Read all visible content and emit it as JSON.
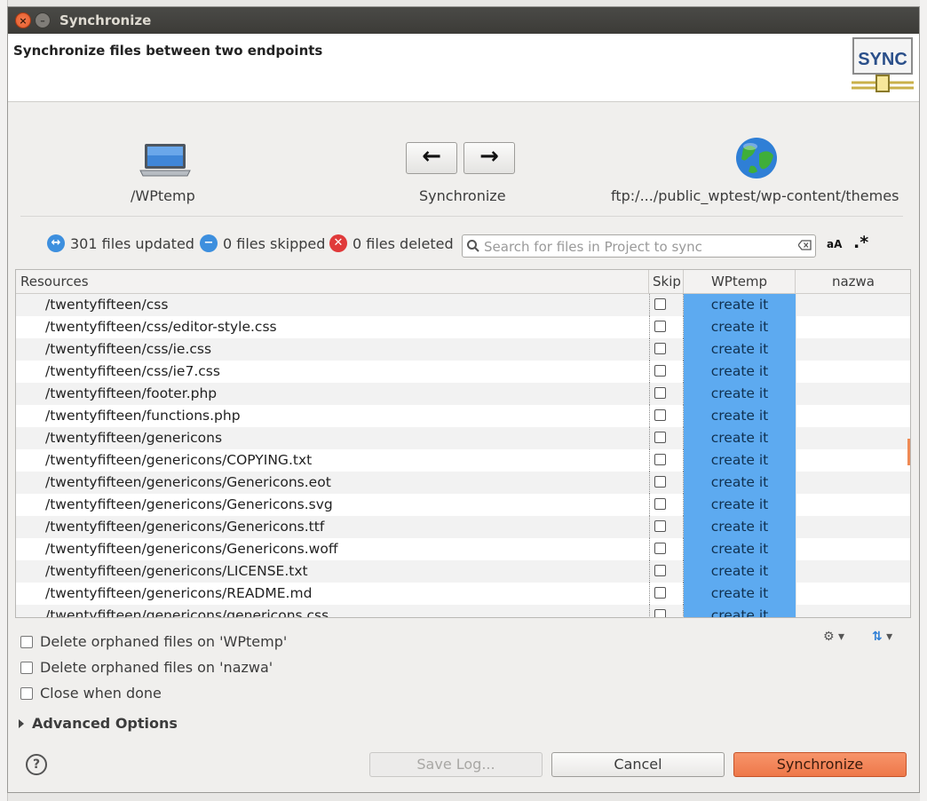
{
  "window": {
    "title": "Synchronize"
  },
  "banner": {
    "title": "Synchronize files between two endpoints",
    "logo_text": "SYNC"
  },
  "endpoints": {
    "source_label": "/WPtemp",
    "action_label": "Synchronize",
    "destination_label": "ftp:/.../public_wptest/wp-content/themes",
    "left_arrow": "←",
    "right_arrow": "→"
  },
  "stats": {
    "updated": "301 files updated",
    "skipped": "0 files skipped",
    "deleted": "0 files deleted"
  },
  "search": {
    "placeholder": "Search for files in Project to sync",
    "case_label": "aA",
    "regex_label": ".*"
  },
  "table": {
    "columns": {
      "resources": "Resources",
      "skip": "Skip",
      "source": "WPtemp",
      "destination": "nazwa"
    },
    "rows": [
      {
        "path": "/twentyfifteen/css",
        "action": "create it"
      },
      {
        "path": "/twentyfifteen/css/editor-style.css",
        "action": "create it"
      },
      {
        "path": "/twentyfifteen/css/ie.css",
        "action": "create it"
      },
      {
        "path": "/twentyfifteen/css/ie7.css",
        "action": "create it"
      },
      {
        "path": "/twentyfifteen/footer.php",
        "action": "create it"
      },
      {
        "path": "/twentyfifteen/functions.php",
        "action": "create it"
      },
      {
        "path": "/twentyfifteen/genericons",
        "action": "create it"
      },
      {
        "path": "/twentyfifteen/genericons/COPYING.txt",
        "action": "create it"
      },
      {
        "path": "/twentyfifteen/genericons/Genericons.eot",
        "action": "create it"
      },
      {
        "path": "/twentyfifteen/genericons/Genericons.svg",
        "action": "create it"
      },
      {
        "path": "/twentyfifteen/genericons/Genericons.ttf",
        "action": "create it"
      },
      {
        "path": "/twentyfifteen/genericons/Genericons.woff",
        "action": "create it"
      },
      {
        "path": "/twentyfifteen/genericons/LICENSE.txt",
        "action": "create it"
      },
      {
        "path": "/twentyfifteen/genericons/README.md",
        "action": "create it"
      },
      {
        "path": "/twentyfifteen/genericons/genericons.css",
        "action": "create it"
      }
    ]
  },
  "options": {
    "delete_orphaned_source": "Delete orphaned files on 'WPtemp'",
    "delete_orphaned_dest": "Delete orphaned files on 'nazwa'",
    "close_when_done": "Close when done",
    "advanced": "Advanced Options"
  },
  "buttons": {
    "save_log": "Save Log...",
    "cancel": "Cancel",
    "synchronize": "Synchronize",
    "help": "?"
  },
  "colors": {
    "accent_button": "#ee784a",
    "create_cell": "#5daaf0",
    "titlebar": "#3c3b37"
  }
}
